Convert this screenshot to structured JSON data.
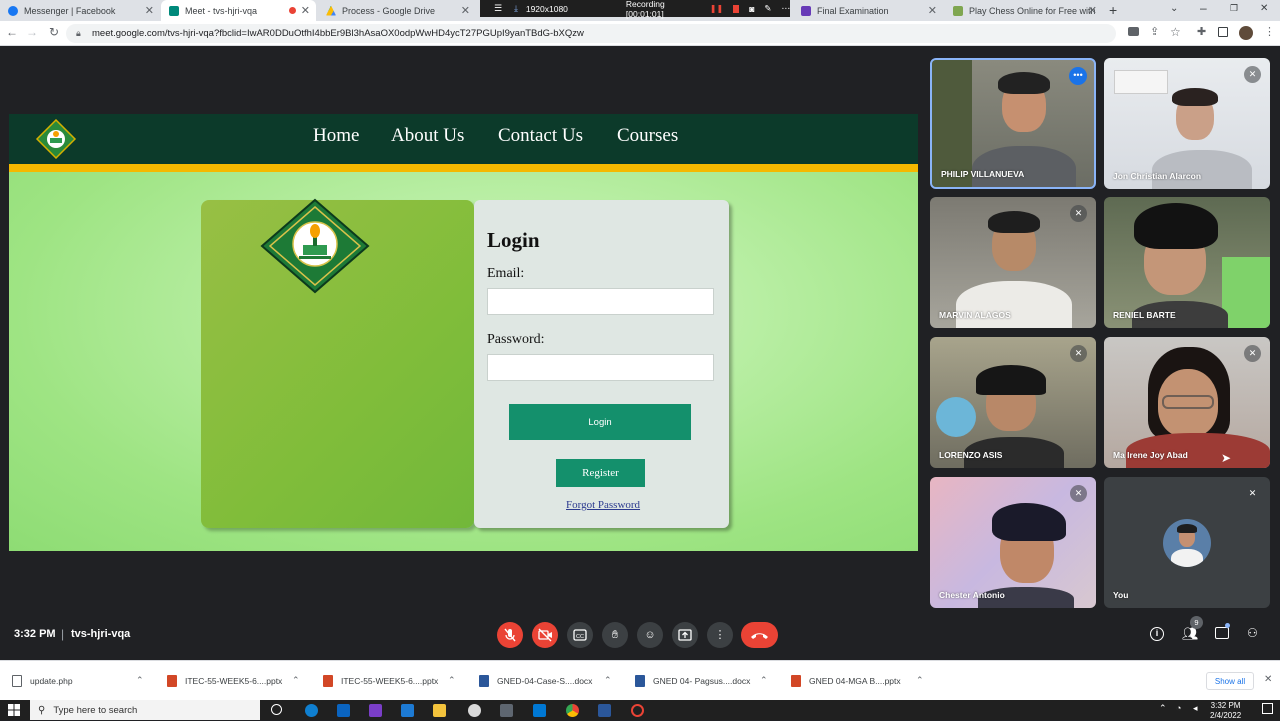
{
  "browser": {
    "tabs": [
      {
        "label": "Messenger | Facebook"
      },
      {
        "label": "Meet - tvs-hjri-vqa"
      },
      {
        "label": "Process - Google Drive"
      },
      {
        "label": "Final Examination"
      },
      {
        "label": "Play Chess Online for Free with"
      }
    ],
    "recording": {
      "resolution": "1920x1080",
      "status": "Recording [00:01:01]"
    },
    "url": "meet.google.com/tvs-hjri-vqa?fbclid=IwAR0DDuOtfhI4bbEr9Bl3hAsaOX0odpWwHD4ycT27PGUpI9yanTBdG-bXQzw"
  },
  "site": {
    "nav": [
      "Home",
      "About Us",
      "Contact Us",
      "Courses"
    ],
    "login": {
      "title": "Login",
      "email_label": "Email:",
      "password_label": "Password:",
      "login_button": "Login",
      "register_button": "Register",
      "forgot_link": "Forgot Password"
    }
  },
  "participants": [
    {
      "name": "PHILIP VILLANUEVA"
    },
    {
      "name": "Jon Christian Alarcon"
    },
    {
      "name": "MARVIN ALAGOS"
    },
    {
      "name": "RENIEL BARTE"
    },
    {
      "name": "LORENZO ASIS"
    },
    {
      "name": "Ma Irene Joy Abad"
    },
    {
      "name": "Chester Antonio"
    },
    {
      "name": "You"
    }
  ],
  "meeting": {
    "time": "3:32 PM",
    "code": "tvs-hjri-vqa",
    "people_count": "9"
  },
  "downloads": {
    "items": [
      "update.php",
      "ITEC-55-WEEK5-6....pptx",
      "ITEC-55-WEEK5-6....pptx",
      "GNED-04-Case-S....docx",
      "GNED 04- Pagsus....docx",
      "GNED 04-MGA B....pptx"
    ],
    "show_all": "Show all"
  },
  "taskbar": {
    "search_placeholder": "Type here to search",
    "clock": "3:32 PM",
    "date": "2/4/2022"
  },
  "colors": {
    "site_nav": "#0c3a2a",
    "accent_green": "#14906c",
    "meet_red": "#ea4335",
    "stripe": "#f5b800"
  }
}
